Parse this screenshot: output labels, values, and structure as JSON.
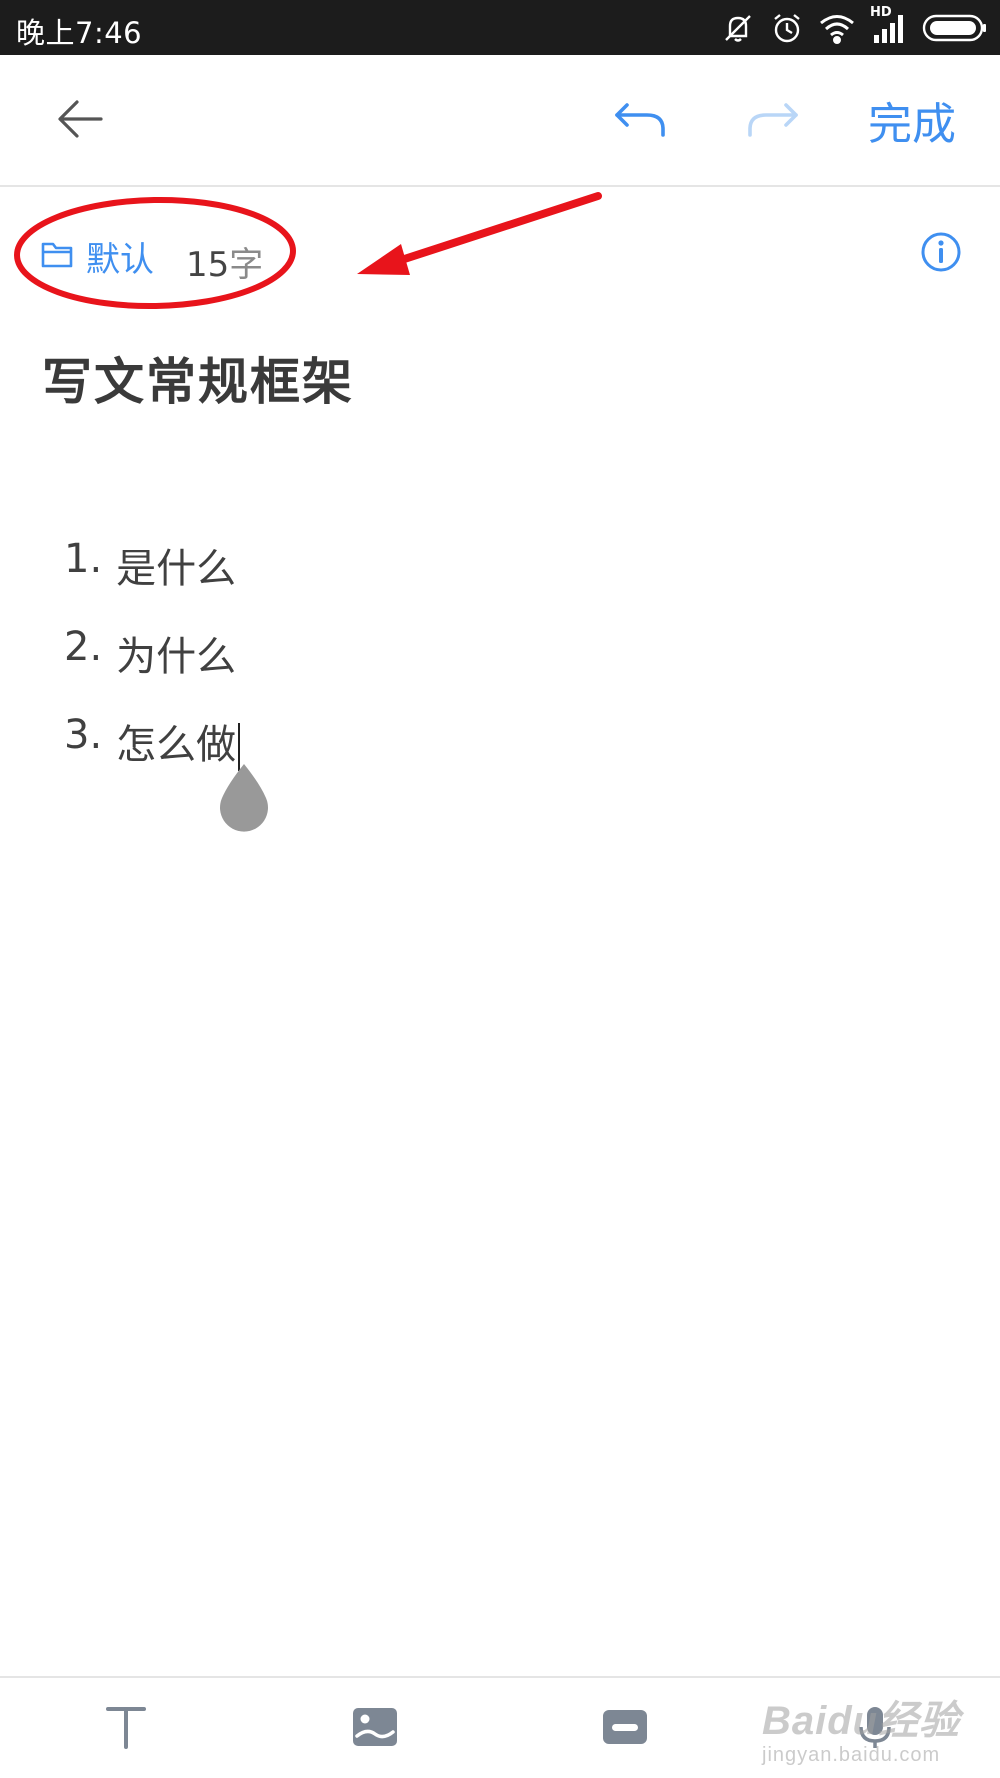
{
  "status_bar": {
    "time": "晚上7:46",
    "network_label": "HD",
    "icons": [
      "mute-icon",
      "alarm-icon",
      "wifi-icon",
      "signal-icon",
      "battery-icon"
    ]
  },
  "toolbar": {
    "back_icon": "back-arrow-icon",
    "undo_icon": "undo-icon",
    "redo_icon": "redo-icon",
    "done_label": "完成"
  },
  "meta": {
    "folder_icon": "folder-icon",
    "folder_label": "默认",
    "word_count": "15",
    "word_count_unit": "字",
    "info_icon": "info-icon"
  },
  "note": {
    "title": "写文常规框架",
    "items": [
      {
        "number": "1.",
        "text": "是什么"
      },
      {
        "number": "2.",
        "text": "为什么"
      },
      {
        "number": "3.",
        "text": "怎么做"
      }
    ]
  },
  "bottom_bar": {
    "items": [
      "text-format-icon",
      "image-icon",
      "audio-icon",
      "microphone-icon"
    ]
  },
  "watermark": {
    "main": "Baidu经验",
    "sub": "jingyan.baidu.com"
  },
  "colors": {
    "accent": "#3f8ff0",
    "accent_disabled": "#b9d6f7",
    "annotation": "#e8141b",
    "status_bar_bg": "#1c1c1c",
    "icon_gray": "#7d8794"
  }
}
